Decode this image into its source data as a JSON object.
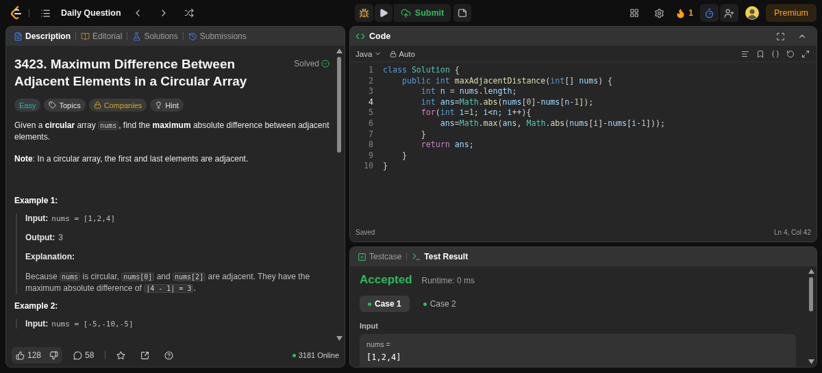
{
  "topbar": {
    "title": "Daily Question",
    "submit": "Submit",
    "streak": "1",
    "premium": "Premium"
  },
  "description_panel": {
    "tabs": [
      {
        "label": "Description",
        "kind": "description",
        "selected": true
      },
      {
        "label": "Editorial",
        "kind": "editorial",
        "selected": false
      },
      {
        "label": "Solutions",
        "kind": "solutions",
        "selected": false
      },
      {
        "label": "Submissions",
        "kind": "submissions",
        "selected": false
      }
    ],
    "title": "3423. Maximum Difference Between Adjacent Elements in a Circular Array",
    "status": "Solved",
    "tags": [
      {
        "label": "Easy",
        "kind": "difficulty"
      },
      {
        "label": "Topics",
        "kind": "topics"
      },
      {
        "label": "Companies",
        "kind": "companies"
      },
      {
        "label": "Hint",
        "kind": "hint"
      }
    ],
    "paragraphs": [
      [
        {
          "kind": "text",
          "text": "Given a **circular** array "
        },
        {
          "kind": "code",
          "text": "nums"
        },
        {
          "kind": "text",
          "text": ", find the **maximum** absolute difference between adjacent elements."
        }
      ],
      [
        {
          "kind": "text",
          "text": "**Note**: In a circular array, the first and last elements are adjacent."
        }
      ]
    ],
    "examples": [
      {
        "heading": "Example 1:",
        "items": [
          {
            "kind": "field",
            "label": "Input:",
            "value": "nums = [1,2,4]",
            "monospace": true
          },
          {
            "kind": "field",
            "label": "Output:",
            "value": "3",
            "monospace": false
          },
          {
            "kind": "label",
            "label": "Explanation:"
          },
          {
            "kind": "paragraph",
            "segments": [
              {
                "kind": "text",
                "text": "Because "
              },
              {
                "kind": "code",
                "text": "nums"
              },
              {
                "kind": "text",
                "text": " is circular, "
              },
              {
                "kind": "code",
                "text": "nums[0]"
              },
              {
                "kind": "text",
                "text": " and "
              },
              {
                "kind": "code",
                "text": "nums[2]"
              },
              {
                "kind": "text",
                "text": " are adjacent. They have the maximum absolute difference of "
              },
              {
                "kind": "code",
                "text": "|4 - 1| = 3"
              },
              {
                "kind": "text",
                "text": "."
              }
            ]
          }
        ]
      },
      {
        "heading": "Example 2:",
        "items": [
          {
            "kind": "field",
            "label": "Input:",
            "value": "nums = [-5,-10,-5]",
            "monospace": true
          }
        ]
      }
    ],
    "footer": {
      "likes": "128",
      "comments": "58",
      "online": "3181 Online"
    }
  },
  "code_panel": {
    "title": "Code",
    "language": "Java",
    "mode": "Auto",
    "lines": [
      {
        "number": "1",
        "current": false,
        "tokens": [
          {
            "text": "class ",
            "kind": "kw"
          },
          {
            "text": "Solution",
            "kind": "type"
          },
          {
            "text": " {",
            "kind": "punct"
          }
        ]
      },
      {
        "number": "2",
        "current": false,
        "tokens": [
          {
            "text": "    public int ",
            "kind": "kw"
          },
          {
            "text": "maxAdjacentDistance",
            "kind": "fn"
          },
          {
            "text": "(",
            "kind": "punct"
          },
          {
            "text": "int",
            "kind": "kw"
          },
          {
            "text": "[] ",
            "kind": "punct"
          },
          {
            "text": "nums",
            "kind": "var"
          },
          {
            "text": ") {",
            "kind": "punct"
          }
        ]
      },
      {
        "number": "3",
        "current": false,
        "tokens": [
          {
            "text": "        int ",
            "kind": "kw"
          },
          {
            "text": "n",
            "kind": "var"
          },
          {
            "text": " = ",
            "kind": "punct"
          },
          {
            "text": "nums",
            "kind": "var"
          },
          {
            "text": ".",
            "kind": "punct"
          },
          {
            "text": "length",
            "kind": "var"
          },
          {
            "text": ";",
            "kind": "punct"
          }
        ]
      },
      {
        "number": "4",
        "current": true,
        "tokens": [
          {
            "text": "        int ",
            "kind": "kw"
          },
          {
            "text": "ans",
            "kind": "var"
          },
          {
            "text": "=",
            "kind": "punct"
          },
          {
            "text": "Math",
            "kind": "type"
          },
          {
            "text": ".",
            "kind": "punct"
          },
          {
            "text": "abs",
            "kind": "fn"
          },
          {
            "text": "(",
            "kind": "punct"
          },
          {
            "text": "nums",
            "kind": "var"
          },
          {
            "text": "[",
            "kind": "punct"
          },
          {
            "text": "0",
            "kind": "num"
          },
          {
            "text": "]-",
            "kind": "punct"
          },
          {
            "text": "nums",
            "kind": "var"
          },
          {
            "text": "[",
            "kind": "punct"
          },
          {
            "text": "n",
            "kind": "var"
          },
          {
            "text": "-",
            "kind": "punct"
          },
          {
            "text": "1",
            "kind": "num"
          },
          {
            "text": "]);",
            "kind": "punct"
          }
        ]
      },
      {
        "number": "5",
        "current": false,
        "tokens": [
          {
            "text": "        for",
            "kind": "ctl"
          },
          {
            "text": "(",
            "kind": "punct"
          },
          {
            "text": "int ",
            "kind": "kw"
          },
          {
            "text": "i",
            "kind": "var"
          },
          {
            "text": "=",
            "kind": "punct"
          },
          {
            "text": "1",
            "kind": "num"
          },
          {
            "text": "; ",
            "kind": "punct"
          },
          {
            "text": "i",
            "kind": "var"
          },
          {
            "text": "<",
            "kind": "punct"
          },
          {
            "text": "n",
            "kind": "var"
          },
          {
            "text": "; ",
            "kind": "punct"
          },
          {
            "text": "i",
            "kind": "var"
          },
          {
            "text": "++){",
            "kind": "punct"
          }
        ]
      },
      {
        "number": "6",
        "current": false,
        "tokens": [
          {
            "text": "            ans",
            "kind": "var"
          },
          {
            "text": "=",
            "kind": "punct"
          },
          {
            "text": "Math",
            "kind": "type"
          },
          {
            "text": ".",
            "kind": "punct"
          },
          {
            "text": "max",
            "kind": "fn"
          },
          {
            "text": "(",
            "kind": "punct"
          },
          {
            "text": "ans",
            "kind": "var"
          },
          {
            "text": ", ",
            "kind": "punct"
          },
          {
            "text": "Math",
            "kind": "type"
          },
          {
            "text": ".",
            "kind": "punct"
          },
          {
            "text": "abs",
            "kind": "fn"
          },
          {
            "text": "(",
            "kind": "punct"
          },
          {
            "text": "nums",
            "kind": "var"
          },
          {
            "text": "[",
            "kind": "punct"
          },
          {
            "text": "i",
            "kind": "var"
          },
          {
            "text": "]-",
            "kind": "punct"
          },
          {
            "text": "nums",
            "kind": "var"
          },
          {
            "text": "[",
            "kind": "punct"
          },
          {
            "text": "i",
            "kind": "var"
          },
          {
            "text": "-",
            "kind": "punct"
          },
          {
            "text": "1",
            "kind": "num"
          },
          {
            "text": "]));",
            "kind": "punct"
          }
        ]
      },
      {
        "number": "7",
        "current": false,
        "tokens": [
          {
            "text": "        }",
            "kind": "punct"
          }
        ]
      },
      {
        "number": "8",
        "current": false,
        "tokens": [
          {
            "text": "        return ",
            "kind": "ctl"
          },
          {
            "text": "ans",
            "kind": "var"
          },
          {
            "text": ";",
            "kind": "punct"
          }
        ]
      },
      {
        "number": "9",
        "current": false,
        "tokens": [
          {
            "text": "    }",
            "kind": "punct"
          }
        ]
      },
      {
        "number": "10",
        "current": false,
        "tokens": [
          {
            "text": "}",
            "kind": "punct"
          }
        ]
      }
    ],
    "save_state": "Saved",
    "cursor": "Ln 4, Col 42"
  },
  "test_panel": {
    "tabs": [
      {
        "label": "Testcase",
        "kind": "testcase",
        "selected": false
      },
      {
        "label": "Test Result",
        "kind": "result",
        "selected": true
      }
    ],
    "verdict": "Accepted",
    "runtime": "Runtime: 0 ms",
    "cases": [
      {
        "label": "Case 1",
        "selected": true
      },
      {
        "label": "Case 2",
        "selected": false
      }
    ],
    "input_label": "Input",
    "input_name": "nums =",
    "input_value": "[1,2,4]"
  }
}
